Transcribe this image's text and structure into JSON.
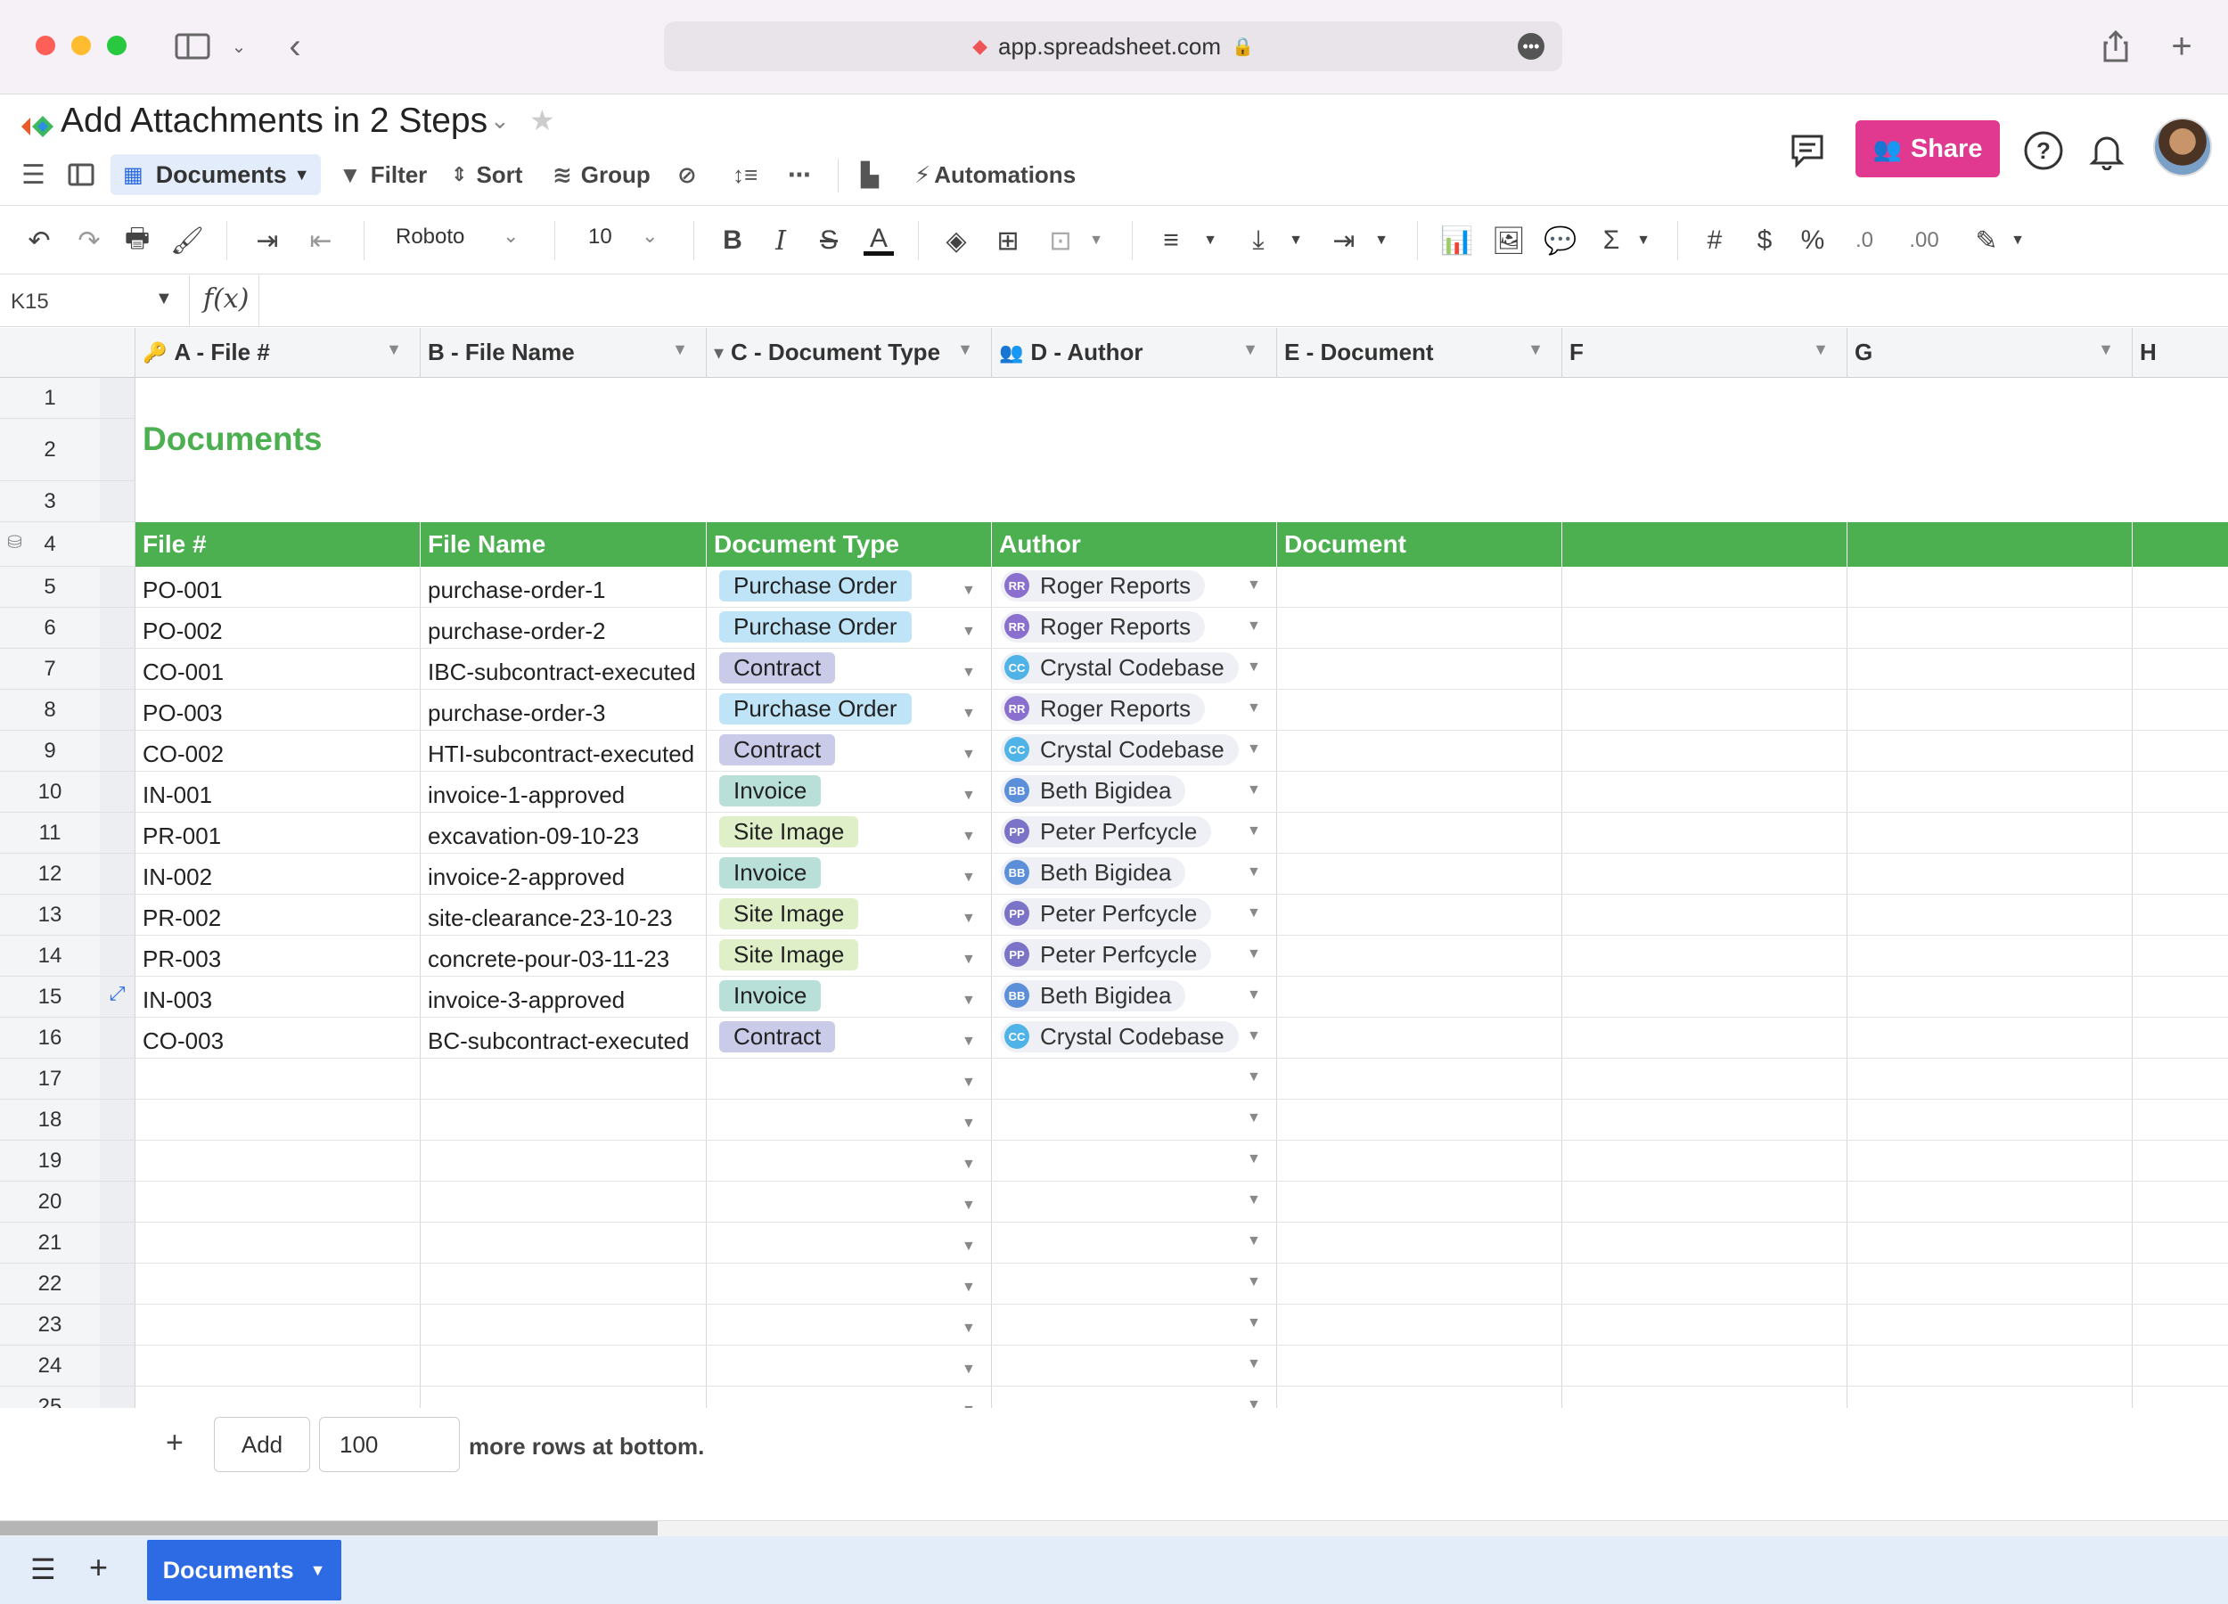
{
  "browser": {
    "url": "app.spreadsheet.com"
  },
  "header": {
    "title": "Add Attachments in 2 Steps",
    "share_label": "Share",
    "share_color": "#e0398f"
  },
  "toolbar": {
    "view_label": "Documents",
    "filter_label": "Filter",
    "sort_label": "Sort",
    "group_label": "Group",
    "automations_label": "Automations"
  },
  "format": {
    "font": "Roboto",
    "size": "10"
  },
  "formula": {
    "cell_ref": "K15"
  },
  "columns": [
    {
      "label": "A - File #",
      "icon": "key-icon"
    },
    {
      "label": "B - File Name",
      "icon": ""
    },
    {
      "label": "C - Document Type",
      "icon": "dropdown-icon"
    },
    {
      "label": "D - Author",
      "icon": "people-icon"
    },
    {
      "label": "E - Document",
      "icon": ""
    },
    {
      "label": "F",
      "icon": ""
    },
    {
      "label": "G",
      "icon": ""
    },
    {
      "label": "H",
      "icon": ""
    }
  ],
  "sheet": {
    "title": "Documents",
    "title_color": "#4caf50",
    "header_row": [
      "File #",
      "File Name",
      "Document Type",
      "Author",
      "Document",
      "",
      "",
      ""
    ],
    "rows": [
      {
        "file": "PO-001",
        "name": "purchase-order-1",
        "type": "Purchase Order",
        "author": "Roger Reports",
        "initials": "RR"
      },
      {
        "file": "PO-002",
        "name": "purchase-order-2",
        "type": "Purchase Order",
        "author": "Roger Reports",
        "initials": "RR"
      },
      {
        "file": "CO-001",
        "name": "IBC-subcontract-executed",
        "type": "Contract",
        "author": "Crystal Codebase",
        "initials": "CC"
      },
      {
        "file": "PO-003",
        "name": "purchase-order-3",
        "type": "Purchase Order",
        "author": "Roger Reports",
        "initials": "RR"
      },
      {
        "file": "CO-002",
        "name": "HTI-subcontract-executed",
        "type": "Contract",
        "author": "Crystal Codebase",
        "initials": "CC"
      },
      {
        "file": "IN-001",
        "name": "invoice-1-approved",
        "type": "Invoice",
        "author": "Beth Bigidea",
        "initials": "BB"
      },
      {
        "file": "PR-001",
        "name": "excavation-09-10-23",
        "type": "Site Image",
        "author": "Peter Perfcycle",
        "initials": "PP"
      },
      {
        "file": "IN-002",
        "name": "invoice-2-approved",
        "type": "Invoice",
        "author": "Beth Bigidea",
        "initials": "BB"
      },
      {
        "file": "PR-002",
        "name": "site-clearance-23-10-23",
        "type": "Site Image",
        "author": "Peter Perfcycle",
        "initials": "PP"
      },
      {
        "file": "PR-003",
        "name": "concrete-pour-03-11-23",
        "type": "Site Image",
        "author": "Peter Perfcycle",
        "initials": "PP"
      },
      {
        "file": "IN-003",
        "name": "invoice-3-approved",
        "type": "Invoice",
        "author": "Beth Bigidea",
        "initials": "BB"
      },
      {
        "file": "CO-003",
        "name": "BC-subcontract-executed",
        "type": "Contract",
        "author": "Crystal Codebase",
        "initials": "CC"
      }
    ],
    "row_numbers": [
      "1",
      "2",
      "3",
      "4",
      "5",
      "6",
      "7",
      "8",
      "9",
      "10",
      "11",
      "12",
      "13",
      "14",
      "15",
      "16",
      "17",
      "18",
      "19",
      "20",
      "21",
      "22",
      "23",
      "24",
      "25"
    ],
    "type_colors": {
      "Purchase Order": "#bfe4f7",
      "Contract": "#c9cbe9",
      "Invoice": "#b8e0d8",
      "Site Image": "#dff0c9"
    },
    "author_colors": {
      "RR": "#8a6fcf",
      "CC": "#4fb3e8",
      "BB": "#5b8fd9",
      "PP": "#7b73c8"
    }
  },
  "footer": {
    "add_label": "Add",
    "add_count": "100",
    "more_rows_text": "more rows at bottom.",
    "tab_label": "Documents"
  }
}
